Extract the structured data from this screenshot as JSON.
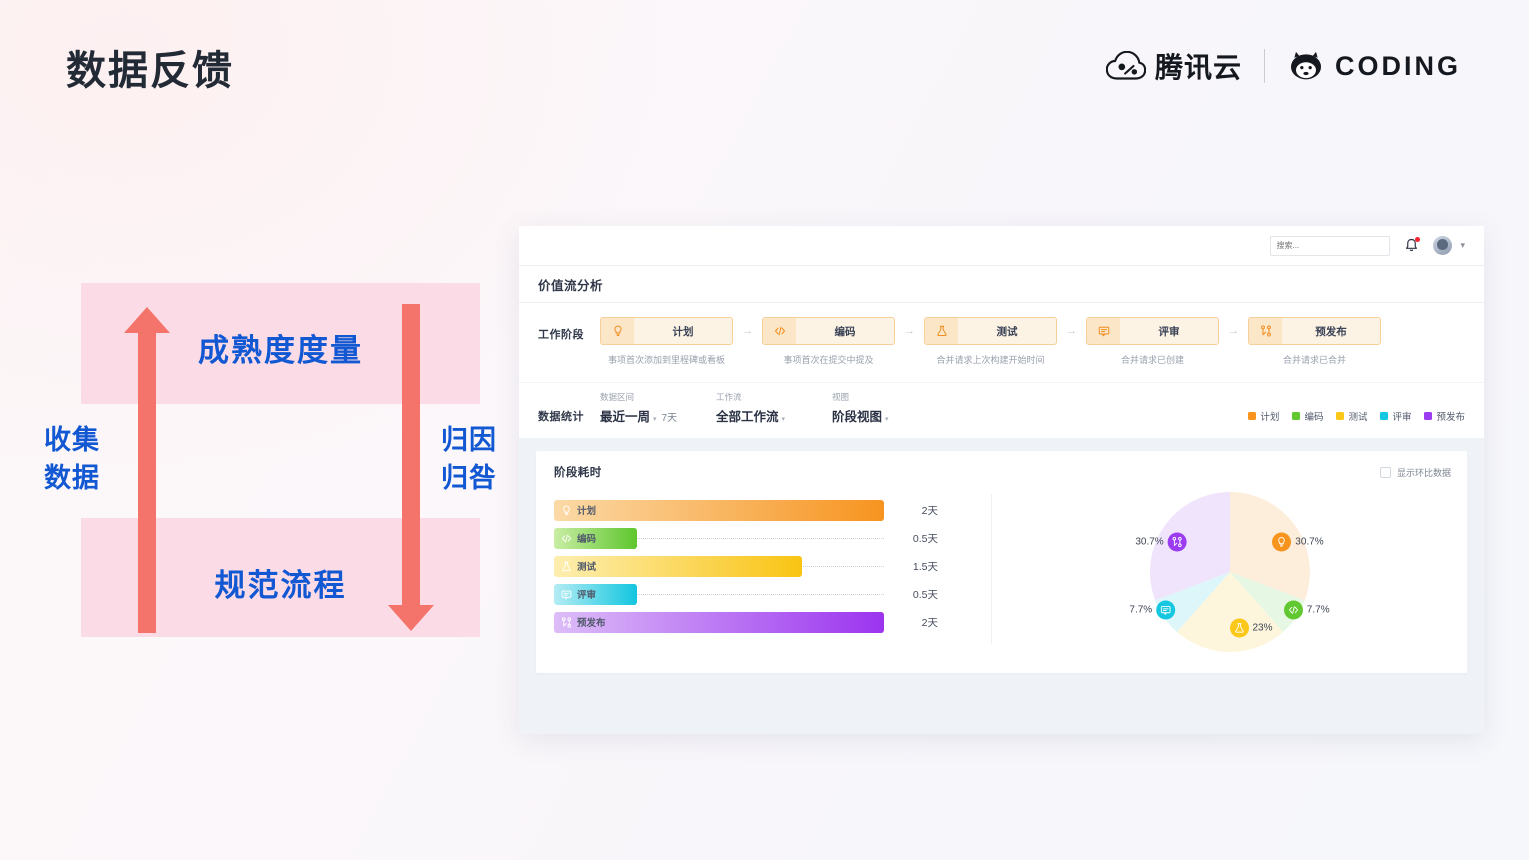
{
  "slide": {
    "title": "数据反馈",
    "brand": {
      "tencent_cloud": "腾讯云",
      "coding": "CODING"
    }
  },
  "diagram": {
    "top_band_label": "成熟度度量",
    "bottom_band_label": "规范流程",
    "left_label_line1": "收集",
    "left_label_line2": "数据",
    "right_label_line1": "归因",
    "right_label_line2": "归咎",
    "up_arrow": "arrow-up-icon",
    "down_arrow": "arrow-down-icon",
    "colors": {
      "band": "#fbdce6",
      "arrow": "#f4736a",
      "text": "#1258d3"
    }
  },
  "app": {
    "topbar": {
      "search_placeholder": "搜索...",
      "search_value": "",
      "bell": "bell-icon",
      "avatar": "avatar-icon",
      "chevron": "chevron-down-icon"
    },
    "page_title": "价值流分析",
    "stage_section": {
      "label": "工作阶段",
      "arrow_glyph": "→",
      "stages": [
        {
          "name": "计划",
          "desc": "事项首次添加到里程碑或看板",
          "icon": "lightbulb-icon"
        },
        {
          "name": "编码",
          "desc": "事项首次在提交中提及",
          "icon": "code-icon"
        },
        {
          "name": "测试",
          "desc": "合并请求上次构建开始时间",
          "icon": "flask-icon"
        },
        {
          "name": "评审",
          "desc": "合并请求已创建",
          "icon": "comment-icon"
        },
        {
          "name": "预发布",
          "desc": "合并请求已合并",
          "icon": "merge-icon"
        }
      ]
    },
    "filter_section": {
      "title": "数据统计",
      "items": [
        {
          "label": "数据区间",
          "value": "最近一周",
          "extra": "7天"
        },
        {
          "label": "工作流",
          "value": "全部工作流",
          "extra": ""
        },
        {
          "label": "视图",
          "value": "阶段视图",
          "extra": ""
        }
      ],
      "legend": [
        {
          "name": "计划",
          "color": "#f7941d"
        },
        {
          "name": "编码",
          "color": "#62c832"
        },
        {
          "name": "测试",
          "color": "#fbc81a"
        },
        {
          "name": "评审",
          "color": "#15c7e0"
        },
        {
          "name": "预发布",
          "color": "#9b3cf0"
        }
      ]
    },
    "chart_card": {
      "title": "阶段耗时",
      "toggle_label": "显示环比数据",
      "toggle_checked": false
    }
  },
  "chart_data": [
    {
      "type": "bar",
      "title": "阶段耗时",
      "orientation": "horizontal",
      "categories": [
        "计划",
        "编码",
        "测试",
        "评审",
        "预发布"
      ],
      "values": [
        2,
        0.5,
        1.5,
        0.5,
        2
      ],
      "value_labels": [
        "2天",
        "0.5天",
        "1.5天",
        "0.5天",
        "2天"
      ],
      "unit": "天",
      "xlabel": "",
      "ylabel": "",
      "xlim": [
        0,
        2
      ],
      "grid": false,
      "legend_position": "none",
      "series_colors": [
        {
          "from": "#fbd9a6",
          "to": "#f79420"
        },
        {
          "from": "#c9eda4",
          "to": "#5ec62d"
        },
        {
          "from": "#fdeeb0",
          "to": "#f9c413"
        },
        {
          "from": "#b4ecf4",
          "to": "#12c6df"
        },
        {
          "from": "#ddbdf8",
          "to": "#9b34ef"
        }
      ]
    },
    {
      "type": "pie",
      "title": "",
      "categories": [
        "计划",
        "编码",
        "测试",
        "评审",
        "预发布"
      ],
      "values": [
        30.7,
        7.7,
        23,
        7.7,
        30.7
      ],
      "value_labels": [
        "30.7%",
        "7.7%",
        "23%",
        "7.7%",
        "30.7%"
      ],
      "slice_colors": [
        "#fdeedc",
        "#e6f7e3",
        "#fdf6dd",
        "#ddf6fa",
        "#f0e4fc"
      ],
      "badge_colors": [
        "#f7941d",
        "#62c832",
        "#fbc81a",
        "#15c7e0",
        "#9b3cf0"
      ],
      "badge_icons": [
        "lightbulb-icon",
        "code-icon",
        "flask-icon",
        "comment-icon",
        "merge-icon"
      ],
      "legend_position": "inline"
    }
  ]
}
